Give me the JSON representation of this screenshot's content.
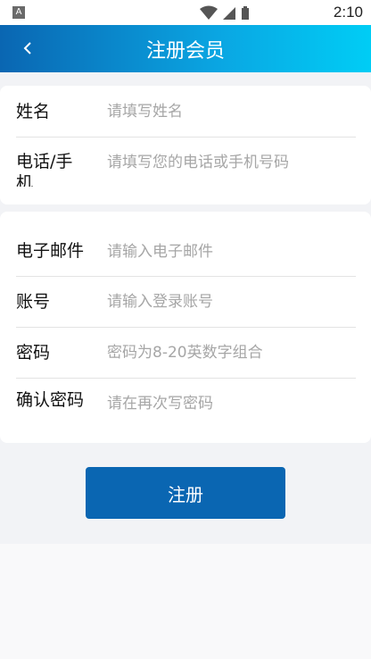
{
  "status_bar": {
    "app_badge": "A",
    "time": "2:10",
    "icons": [
      "wifi-icon",
      "signal-icon",
      "battery-icon"
    ]
  },
  "header": {
    "title": "注册会员",
    "back_icon": "chevron-left-icon"
  },
  "form": {
    "name": {
      "label": "姓名",
      "placeholder": "请填写姓名"
    },
    "phone": {
      "label": "电话/手机",
      "placeholder": "请填写您的电话或手机号码"
    },
    "email": {
      "label": "电子邮件",
      "placeholder": "请输入电子邮件"
    },
    "account": {
      "label": "账号",
      "placeholder": "请输入登录账号"
    },
    "password": {
      "label": "密码",
      "placeholder": "密码为8-20英数字组合"
    },
    "confirm": {
      "label": "确认密码",
      "placeholder": "请在再次写密码"
    }
  },
  "submit": {
    "label": "注册"
  },
  "colors": {
    "primary": "#0a66b2",
    "header_end": "#00cdf5",
    "placeholder": "#a6a6a6",
    "background": "#f2f3f6"
  }
}
